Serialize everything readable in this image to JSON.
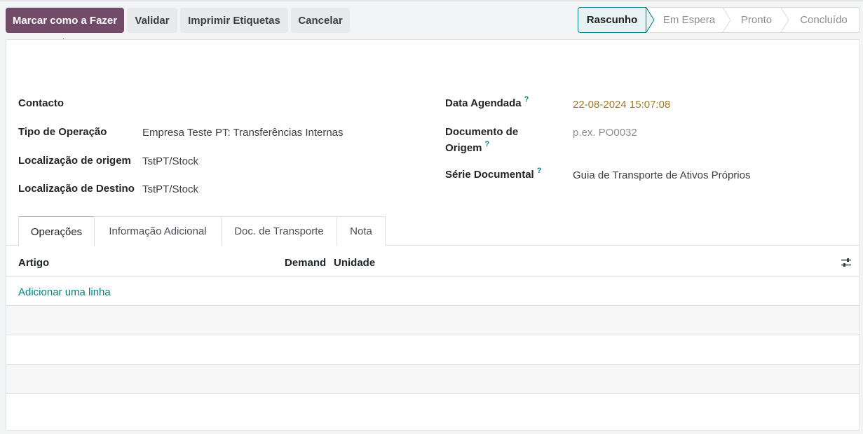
{
  "actions": {
    "mark_todo": "Marcar como a Fazer",
    "validate": "Validar",
    "print_labels": "Imprimir Etiquetas",
    "cancel": "Cancelar"
  },
  "statusbar": {
    "steps": [
      "Rascunho",
      "Em Espera",
      "Pronto",
      "Concluído"
    ],
    "active": "Rascunho"
  },
  "form": {
    "left": {
      "contact_label": "Contacto",
      "contact_value": "",
      "operation_type_label": "Tipo de Operação",
      "operation_type_value": "Empresa Teste PT: Transferências Internas",
      "source_location_label": "Localização de origem",
      "source_location_value": "TstPT/Stock",
      "dest_location_label": "Localização de Destino",
      "dest_location_value": "TstPT/Stock"
    },
    "right": {
      "scheduled_date_label": "Data Agendada",
      "scheduled_date_value": "22-08-2024 15:07:08",
      "source_doc_label_line1": "Documento de",
      "source_doc_label_line2": "Origem",
      "source_doc_placeholder": "p.ex. PO0032",
      "doc_series_label": "Série Documental",
      "doc_series_value": "Guia de Transporte de Ativos Próprios"
    },
    "help_mark": "?"
  },
  "tabs": [
    "Operações",
    "Informação Adicional",
    "Doc. de Transporte",
    "Nota"
  ],
  "table": {
    "columns": [
      "Artigo",
      "Demand",
      "Unidade"
    ],
    "add_line": "Adicionar uma linha",
    "rows": []
  },
  "colors": {
    "primary": "#714b67",
    "accent": "#017e84",
    "date": "#a17a2a",
    "annotation_arrow": "#e8141c"
  },
  "icons": {
    "annotation": "red-up-arrow",
    "optional_columns": "sliders-icon"
  }
}
